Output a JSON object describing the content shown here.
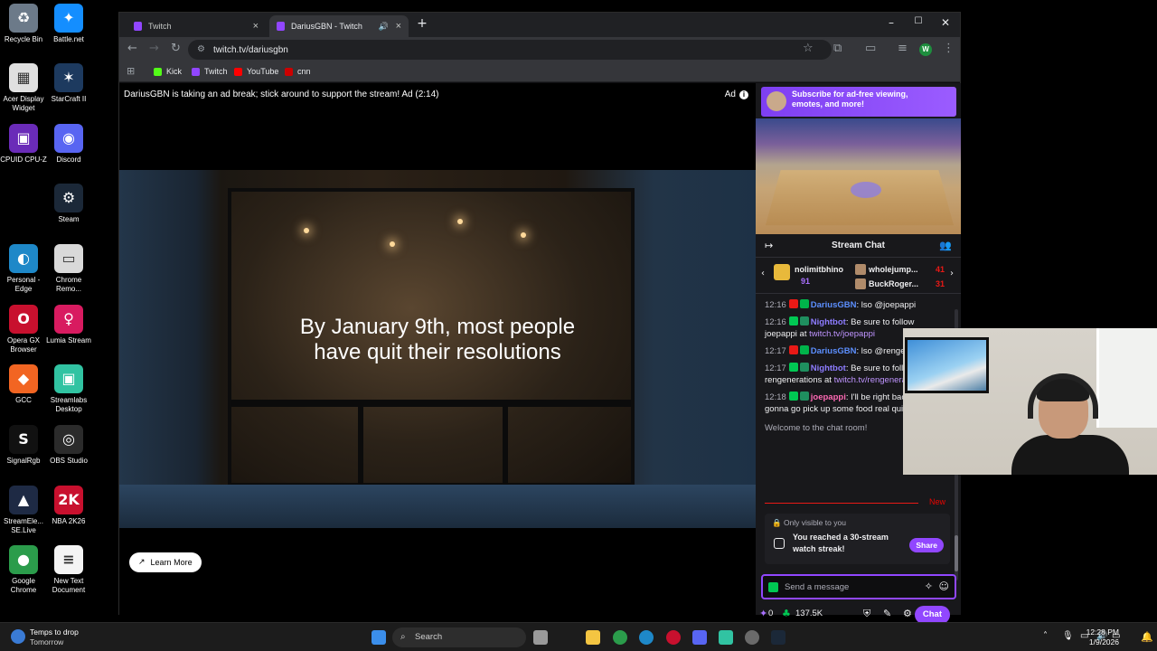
{
  "desktop": {
    "icons": [
      {
        "label": "Recycle Bin",
        "color": "#6c7a89",
        "glyph": "♻"
      },
      {
        "label": "Battle.net",
        "color": "#148eff",
        "glyph": "✦"
      },
      {
        "label": "Acer Display Widget",
        "color": "#e0e0e0",
        "glyph": "▦"
      },
      {
        "label": "StarCraft II",
        "color": "#1d3a5f",
        "glyph": "✶"
      },
      {
        "label": "CPUID CPU-Z",
        "color": "#6a2bb8",
        "glyph": "▣"
      },
      {
        "label": "Discord",
        "color": "#5865f2",
        "glyph": "◉"
      },
      {
        "label": "Steam",
        "color": "#1b2838",
        "glyph": "⚙"
      },
      {
        "label": "Personal - Edge",
        "color": "#1e88c8",
        "glyph": "◐"
      },
      {
        "label": "Chrome Remo...",
        "color": "#d9d9d9",
        "glyph": "▭"
      },
      {
        "label": "Opera GX Browser",
        "color": "#c8102e",
        "glyph": "O"
      },
      {
        "label": "Lumia Stream",
        "color": "#d81b60",
        "glyph": "♀"
      },
      {
        "label": "GCC",
        "color": "#f26522",
        "glyph": "◆"
      },
      {
        "label": "Streamlabs Desktop",
        "color": "#31c3a2",
        "glyph": "▣"
      },
      {
        "label": "SignalRgb",
        "color": "#111111",
        "glyph": "S"
      },
      {
        "label": "OBS Studio",
        "color": "#2b2b2b",
        "glyph": "◎"
      },
      {
        "label": "StreamEle... SE.Live",
        "color": "#1e2a44",
        "glyph": "▲"
      },
      {
        "label": "NBA 2K26",
        "color": "#c8102e",
        "glyph": "2K"
      },
      {
        "label": "Google Chrome",
        "color": "#2b9c4b",
        "glyph": "●"
      },
      {
        "label": "New Text Document",
        "color": "#f4f4f4",
        "glyph": "≡"
      }
    ]
  },
  "browser": {
    "tabs": [
      {
        "title": "Twitch",
        "active": false
      },
      {
        "title": "DariusGBN - Twitch",
        "active": true
      }
    ],
    "new_tab": "+",
    "url": "twitch.tv/dariusgbn",
    "bookmarks": [
      {
        "label": "Kick",
        "color": "#53fc18"
      },
      {
        "label": "Twitch",
        "color": "#9146ff"
      },
      {
        "label": "YouTube",
        "color": "#ff0000"
      },
      {
        "label": "cnn",
        "color": "#cc0000"
      }
    ],
    "profile_initial": "W"
  },
  "player": {
    "ad_banner": "DariusGBN is taking an ad break; stick around to support the stream! Ad (2:14)",
    "ad_label": "Ad",
    "headline_line1": "By January 9th, most people",
    "headline_line2": "have quit their resolutions",
    "learn_more": "Learn More"
  },
  "sidebar": {
    "sub_banner_line1": "Subscribe for ad-free viewing,",
    "sub_banner_line2": "emotes, and more!",
    "chat_title": "Stream Chat",
    "leaderboard": {
      "gifter": {
        "name": "nolimitbhino",
        "count": "91"
      },
      "cheerers": [
        {
          "name": "wholejump...",
          "count": "41"
        },
        {
          "name": "BuckRoger...",
          "count": "31"
        }
      ]
    },
    "messages": [
      {
        "time": "12:16",
        "user": "DariusGBN",
        "color": "#5c8fff",
        "badge_colors": [
          "#e91916",
          "#00b34a"
        ],
        "text": ": lso @joepappi",
        "link": ""
      },
      {
        "time": "12:16",
        "user": "Nightbot",
        "color": "#8d7cff",
        "badge_colors": [
          "#00c853",
          "#1f8f5f"
        ],
        "text": ": Be sure to follow joepappi at ",
        "link": "twitch.tv/joepappi"
      },
      {
        "time": "12:17",
        "user": "DariusGBN",
        "color": "#5c8fff",
        "badge_colors": [
          "#e91916",
          "#00b34a"
        ],
        "text": ": lso @rengenerations",
        "link": ""
      },
      {
        "time": "12:17",
        "user": "Nightbot",
        "color": "#8d7cff",
        "badge_colors": [
          "#00c853",
          "#1f8f5f"
        ],
        "text": ": Be sure to follow rengenerations at ",
        "link": "twitch.tv/rengenerations"
      },
      {
        "time": "12:18",
        "user": "joepappi",
        "color": "#ff69b4",
        "badge_colors": [
          "#00c853",
          "#1f8f5f"
        ],
        "text": ": I'll be right back brutha gonna go pick up some food real quick",
        "link": ""
      }
    ],
    "welcome": "Welcome to the chat room!",
    "new_label": "New",
    "notice": {
      "visibility": "Only visible to you",
      "text": "You reached a 30-stream watch streak!",
      "share": "Share"
    },
    "input_placeholder": "Send a message",
    "points_a": "0",
    "points_b": "137.5K",
    "chat_button": "Chat"
  },
  "taskbar": {
    "weather_title": "Temps to drop",
    "weather_sub": "Tomorrow",
    "search": "Search",
    "time": "12:28 PM",
    "date": "1/9/2026",
    "apps": [
      {
        "name": "start",
        "color": "#3b8eea"
      },
      {
        "name": "widgets",
        "color": "#8a8a8a"
      },
      {
        "name": "task-view",
        "color": "#9a9a9a"
      },
      {
        "name": "file-explorer",
        "color": "#f4c542"
      },
      {
        "name": "chrome",
        "color": "#2b9c4b"
      },
      {
        "name": "edge",
        "color": "#1e88c8"
      },
      {
        "name": "opera",
        "color": "#c8102e"
      },
      {
        "name": "discord",
        "color": "#5865f2"
      },
      {
        "name": "streamlabs",
        "color": "#31c3a2"
      },
      {
        "name": "obs",
        "color": "#6a6a6a"
      },
      {
        "name": "steam",
        "color": "#1b2838"
      }
    ]
  }
}
